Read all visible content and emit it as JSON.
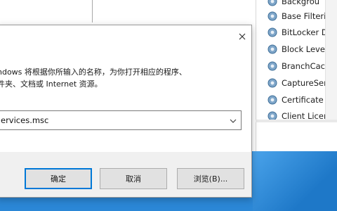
{
  "services_list": {
    "items": [
      {
        "label": "Backgrou"
      },
      {
        "label": "Base Filtering"
      },
      {
        "label": "BitLocker Dr"
      },
      {
        "label": "Block Level"
      },
      {
        "label": "BranchCach"
      },
      {
        "label": "CaptureServ"
      },
      {
        "label": "Certificate P"
      },
      {
        "label": "Client Licens"
      }
    ],
    "icon": "gear-icon"
  },
  "run_dialog": {
    "description_line1": "ndows 将根据你所输入的名称，为你打开相应的程序、",
    "description_line2": "件夹、文档或 Internet 资源。",
    "open_field": {
      "value": "ervices.msc"
    },
    "buttons": {
      "ok": "确定",
      "cancel": "取消",
      "browse": "浏览(B)..."
    },
    "close_icon": "close-icon"
  },
  "colors": {
    "desktop_blue": "#2b87d6",
    "default_button_border": "#0078d7",
    "dialog_footer": "#f0f0f0"
  }
}
